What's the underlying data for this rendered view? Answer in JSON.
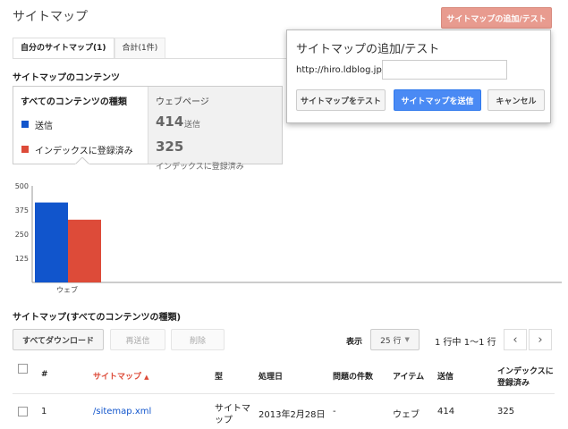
{
  "header": {
    "title": "サイトマップ",
    "add_test_button": "サイトマップの追加/テスト"
  },
  "tabs": [
    {
      "label": "自分のサイトマップ(1)"
    },
    {
      "label": "合計(1件)"
    }
  ],
  "contents_section": {
    "title": "サイトマップのコンテンツ"
  },
  "legend": {
    "left_header": "すべてのコンテンツの種類",
    "items": [
      {
        "label": "送信",
        "color": "#1155cc"
      },
      {
        "label": "インデックスに登録済み",
        "color": "#dd4b39"
      }
    ],
    "right_header": "ウェブページ",
    "submitted_value": "414",
    "submitted_label": "送信",
    "indexed_value": "325",
    "indexed_label": "インデックスに登録済み"
  },
  "popup": {
    "title": "サイトマップの追加/テスト",
    "url_prefix": "http://hiro.ldblog.jp/",
    "input_value": "",
    "test_button": "サイトマップをテスト",
    "submit_button": "サイトマップを送信",
    "cancel_button": "キャンセル"
  },
  "chart_data": {
    "type": "bar",
    "categories": [
      "ウェブ"
    ],
    "series": [
      {
        "name": "送信",
        "values": [
          414
        ],
        "color": "#1155cc"
      },
      {
        "name": "インデックスに登録済み",
        "values": [
          325
        ],
        "color": "#dd4b39"
      }
    ],
    "yticks": [
      125,
      250,
      375,
      500
    ],
    "ylim": [
      0,
      500
    ],
    "grid": false
  },
  "list_section": {
    "title": "サイトマップ(すべてのコンテンツの種類)",
    "download_all": "すべてダウンロード",
    "resubmit": "再送信",
    "delete": "削除",
    "show_label": "表示",
    "rows_select": "25 行",
    "range": "1 行中 1〜1 行"
  },
  "table": {
    "headers": {
      "num": "#",
      "sitemap": "サイトマップ",
      "type": "型",
      "processed": "処理日",
      "issues": "問題の件数",
      "item": "アイテム",
      "submitted": "送信",
      "indexed1": "インデックスに",
      "indexed2": "登録済み"
    },
    "rows": [
      {
        "num": "1",
        "sitemap": "/sitemap.xml",
        "type1": "サイトマ",
        "type2": "ップ",
        "processed": "2013年2月28日",
        "issues": "-",
        "item": "ウェブ",
        "submitted": "414",
        "indexed": "325"
      }
    ]
  }
}
